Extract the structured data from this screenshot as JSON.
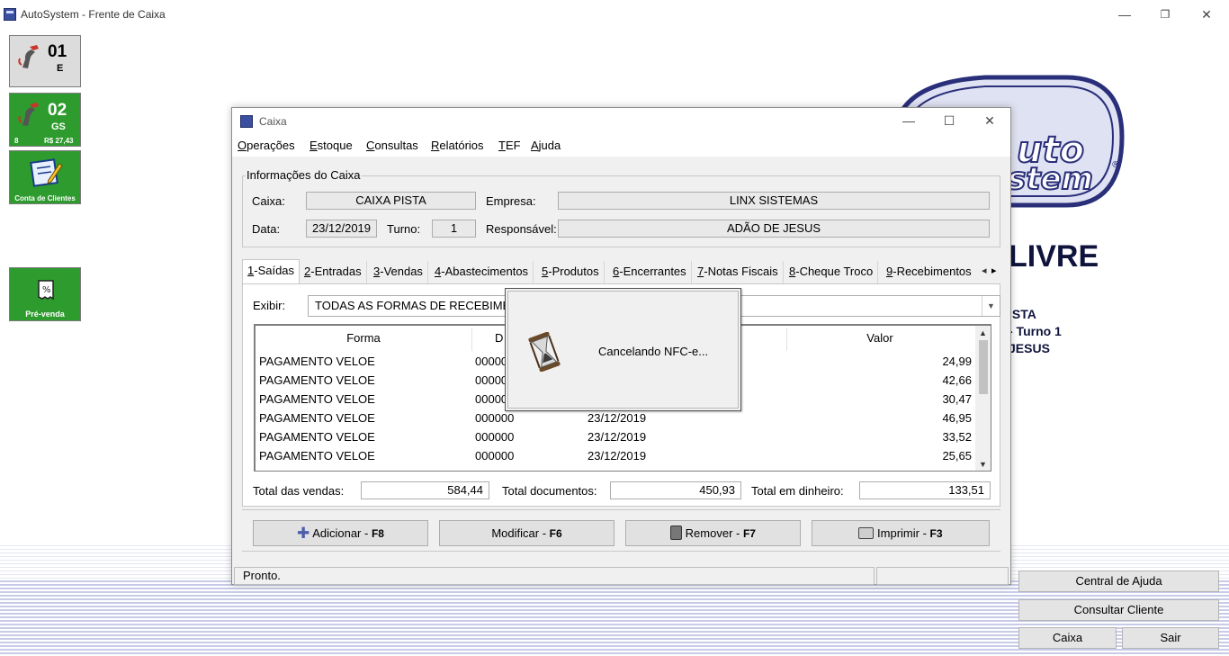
{
  "window": {
    "title": "AutoSystem - Frente de Caixa",
    "controls": [
      "—",
      "❐",
      "✕"
    ]
  },
  "tiles": [
    {
      "number": "01",
      "code": "E"
    },
    {
      "number": "02",
      "code": "GS",
      "left_small": "8",
      "right_small": "R$ 27,43"
    },
    {
      "caption": "Conta de Clientes"
    },
    {
      "caption": "Pré-venda"
    }
  ],
  "background": {
    "status": "LIVRE",
    "line1": "ISTA",
    "line2": "- Turno 1",
    "line3": "JESUS"
  },
  "right_buttons": {
    "help": "Central de Ajuda",
    "client": "Consultar Cliente",
    "caixa": "Caixa",
    "sair": "Sair"
  },
  "caixa": {
    "title": "Caixa",
    "controls": [
      "—",
      "☐",
      "✕"
    ],
    "menu": [
      {
        "first": "O",
        "rest": "perações"
      },
      {
        "first": "E",
        "rest": "stoque"
      },
      {
        "first": "C",
        "rest": "onsultas"
      },
      {
        "first": "R",
        "rest": "elatórios"
      },
      {
        "first": "T",
        "rest": "EF"
      },
      {
        "first": "A",
        "rest": "juda"
      }
    ],
    "info": {
      "legend": "Informações do Caixa",
      "caixa_label": "Caixa:",
      "caixa_value": "CAIXA PISTA",
      "empresa_label": "Empresa:",
      "empresa_value": "LINX SISTEMAS",
      "data_label": "Data:",
      "data_value": "23/12/2019",
      "turno_label": "Turno:",
      "turno_value": "1",
      "responsavel_label": "Responsável:",
      "responsavel_value": "ADÃO DE JESUS"
    },
    "tabs": [
      {
        "key": "1",
        "label": "-Saídas"
      },
      {
        "key": "2",
        "label": "-Entradas"
      },
      {
        "key": "3",
        "label": "-Vendas"
      },
      {
        "key": "4",
        "label": "-Abastecimentos"
      },
      {
        "key": "5",
        "label": "-Produtos"
      },
      {
        "key": "6",
        "label": "-Encerrantes"
      },
      {
        "key": "7",
        "label": "-Notas Fiscais"
      },
      {
        "key": "8",
        "label": "-Cheque Troco"
      },
      {
        "key": "9",
        "label": "-Recebimentos"
      }
    ],
    "tab_arrows": [
      "◂",
      "▸"
    ],
    "exibir_label": "Exibir:",
    "exibir_value": "TODAS AS FORMAS DE RECEBIMENTO",
    "grid": {
      "columns": [
        "Forma",
        "D",
        "Valor"
      ],
      "rows": [
        {
          "forma": "PAGAMENTO VELOE",
          "doc": "00000",
          "data": "",
          "valor": "24,99"
        },
        {
          "forma": "PAGAMENTO VELOE",
          "doc": "00000",
          "data": "",
          "valor": "42,66"
        },
        {
          "forma": "PAGAMENTO VELOE",
          "doc": "00000",
          "data": "",
          "valor": "30,47"
        },
        {
          "forma": "PAGAMENTO VELOE",
          "doc": "000000",
          "data": "23/12/2019",
          "valor": "46,95"
        },
        {
          "forma": "PAGAMENTO VELOE",
          "doc": "000000",
          "data": "23/12/2019",
          "valor": "33,52"
        },
        {
          "forma": "PAGAMENTO VELOE",
          "doc": "000000",
          "data": "23/12/2019",
          "valor": "25,65"
        }
      ]
    },
    "totals": {
      "vendas_label": "Total das vendas:",
      "vendas_value": "584,44",
      "documentos_label": "Total documentos:",
      "documentos_value": "450,93",
      "dinheiro_label": "Total em dinheiro:",
      "dinheiro_value": "133,51"
    },
    "buttons": {
      "adicionar": "Adicionar - ",
      "adicionar_key": "F8",
      "modificar": "Modificar - ",
      "modificar_key": "F6",
      "remover": "Remover - ",
      "remover_key": "F7",
      "imprimir": "Imprimir - ",
      "imprimir_key": "F3"
    },
    "status": "Pronto."
  },
  "popup": {
    "message": "Cancelando NFC-e..."
  },
  "colors": {
    "green_tile": "#2e9b2e",
    "logo_navy": "#2a2f7a",
    "status_navy": "#10143d"
  }
}
